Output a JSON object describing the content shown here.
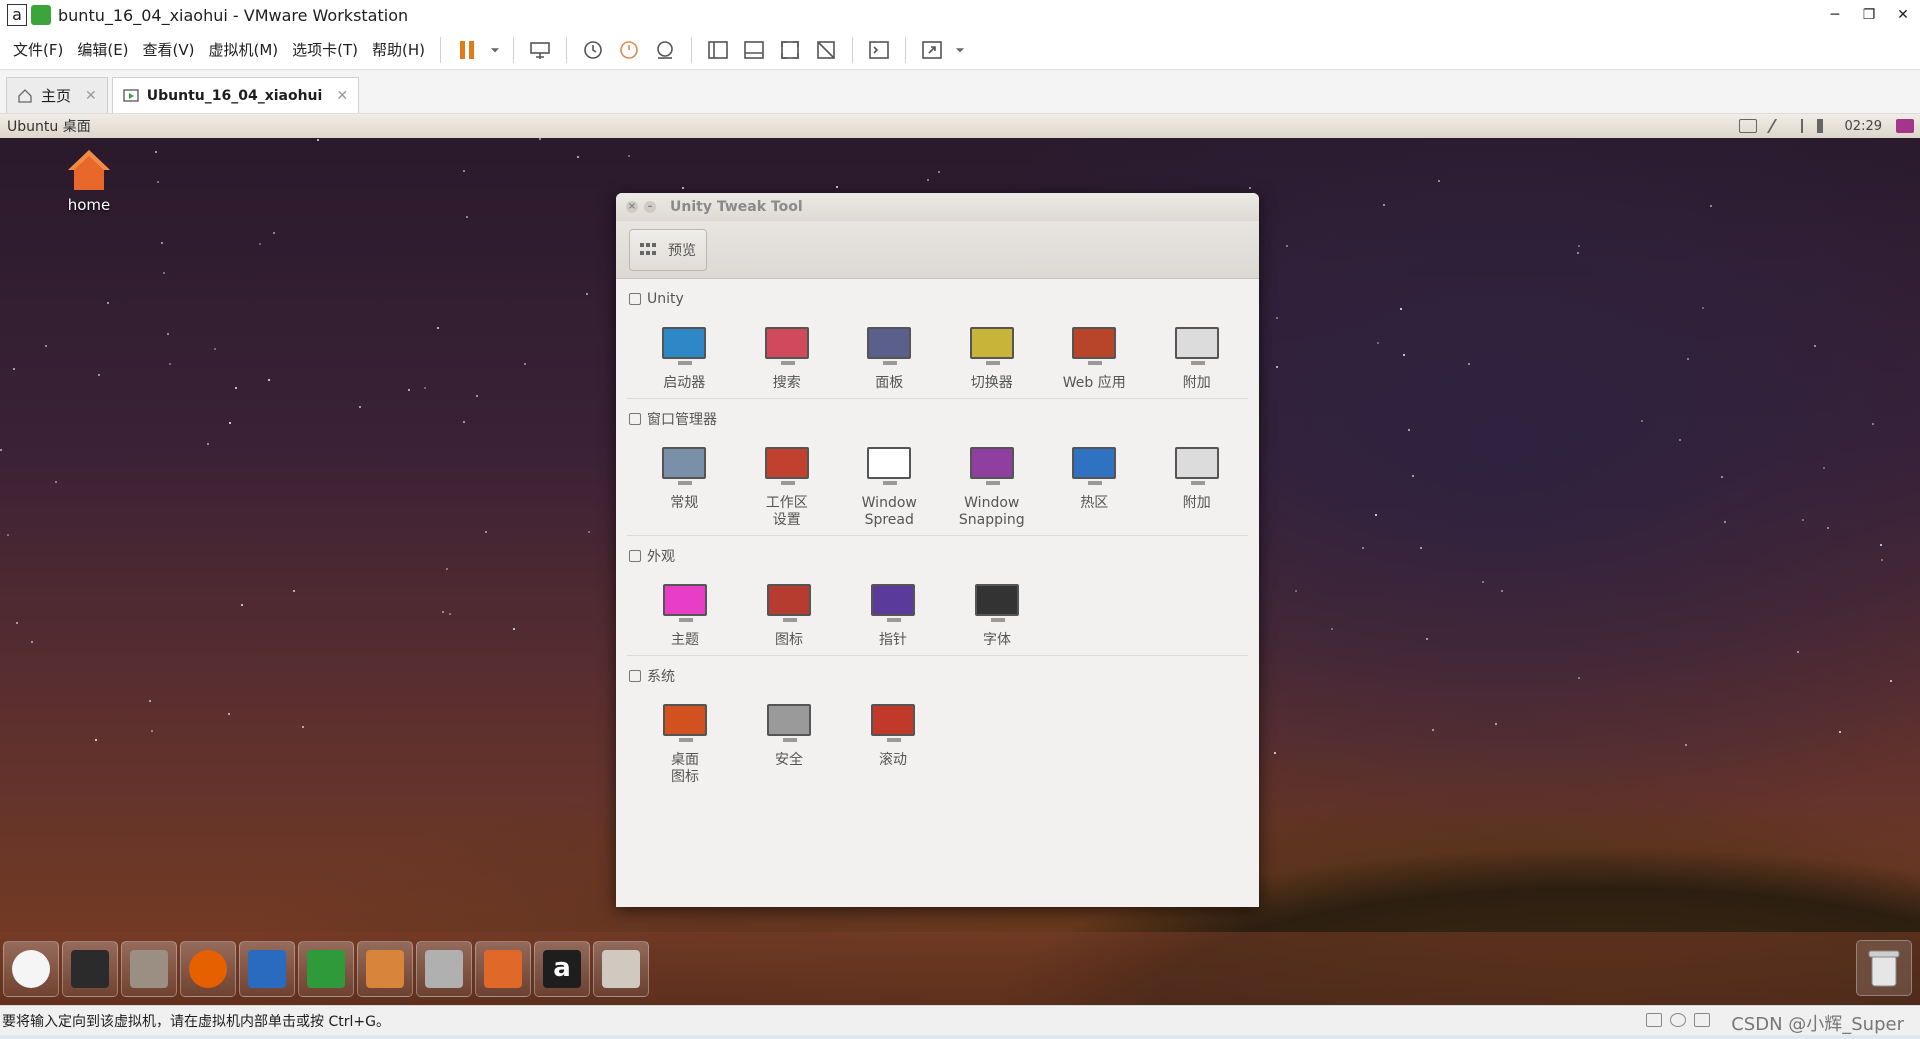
{
  "window": {
    "title": "buntu_16_04_xiaohui - VMware Workstation",
    "icon_letter": "a",
    "controls": [
      "─",
      "❐",
      "✕"
    ]
  },
  "menubar": {
    "items": [
      "文件(F)",
      "编辑(E)",
      "查看(V)",
      "虚拟机(M)",
      "选项卡(T)",
      "帮助(H)"
    ]
  },
  "toolbar": {
    "icons": [
      "pause-icon",
      "send-ctrl-alt-del-icon",
      "snapshot-icon",
      "revert-snapshot-icon",
      "snapshot-manager-icon",
      "library-icon",
      "thumbnail-icon",
      "fullscreen-icon",
      "unity-icon",
      "console-icon",
      "stretch-icon"
    ],
    "pause_color": "#e07b1a"
  },
  "tabs": [
    {
      "label": "主页",
      "close": "✕"
    },
    {
      "label": "Ubuntu_16_04_xiaohui",
      "close": "✕"
    }
  ],
  "guest": {
    "topbar_title": "Ubuntu 桌面",
    "clock": "02:29",
    "desktop_icon_label": "home"
  },
  "utt": {
    "title": "Unity Tweak Tool",
    "overview_label": "预览",
    "sections": [
      {
        "title": "Unity",
        "items": [
          {
            "label": "启动器",
            "color": "#2e88c7"
          },
          {
            "label": "搜索",
            "color": "#d14a5c"
          },
          {
            "label": "面板",
            "color": "#5a5f8c"
          },
          {
            "label": "切换器",
            "color": "#c9b43a"
          },
          {
            "label": "Web 应用",
            "color": "#b8452a"
          },
          {
            "label": "附加",
            "color": "#dcdcdc"
          }
        ]
      },
      {
        "title": "窗口管理器",
        "items": [
          {
            "label": "常规",
            "color": "#7a8fa8"
          },
          {
            "label": "工作区\n设置",
            "color": "#c2412e"
          },
          {
            "label": "Window\nSpread",
            "color": "#ffffff"
          },
          {
            "label": "Window\nSnapping",
            "color": "#8e3fa0"
          },
          {
            "label": "热区",
            "color": "#2f72c2"
          },
          {
            "label": "附加",
            "color": "#dcdcdc"
          }
        ]
      },
      {
        "title": "外观",
        "items": [
          {
            "label": "主题",
            "color": "#e83ec7"
          },
          {
            "label": "图标",
            "color": "#b53c2f"
          },
          {
            "label": "指针",
            "color": "#5a3a9a"
          },
          {
            "label": "字体",
            "color": "#333333"
          }
        ]
      },
      {
        "title": "系统",
        "items": [
          {
            "label": "桌面\n图标",
            "color": "#d2521f"
          },
          {
            "label": "安全",
            "color": "#9a9a9a"
          },
          {
            "label": "滚动",
            "color": "#c0392b"
          }
        ]
      }
    ]
  },
  "launcher": {
    "items": [
      {
        "name": "dash-launcher-icon",
        "color": "#f5f5f5"
      },
      {
        "name": "terminal-launcher-icon",
        "color": "#2b2b2b"
      },
      {
        "name": "files-launcher-icon",
        "color": "#9a8f82"
      },
      {
        "name": "firefox-launcher-icon",
        "color": "#e66000"
      },
      {
        "name": "writer-launcher-icon",
        "color": "#2a6bbf"
      },
      {
        "name": "calc-launcher-icon",
        "color": "#2f9a3a"
      },
      {
        "name": "impress-launcher-icon",
        "color": "#d8843a"
      },
      {
        "name": "settings-launcher-icon",
        "color": "#b0b0b0"
      },
      {
        "name": "software-center-launcher-icon",
        "color": "#e0692a"
      },
      {
        "name": "amazon-launcher-icon",
        "color": "#1e1e1e"
      },
      {
        "name": "unity-tweak-launcher-icon",
        "color": "#cfc9c0"
      }
    ],
    "amazon_letter": "a"
  },
  "statusbar": {
    "message": "要将输入定向到该虚拟机，请在虚拟机内部单击或按 Ctrl+G。",
    "watermark": "CSDN @小辉_Super"
  }
}
